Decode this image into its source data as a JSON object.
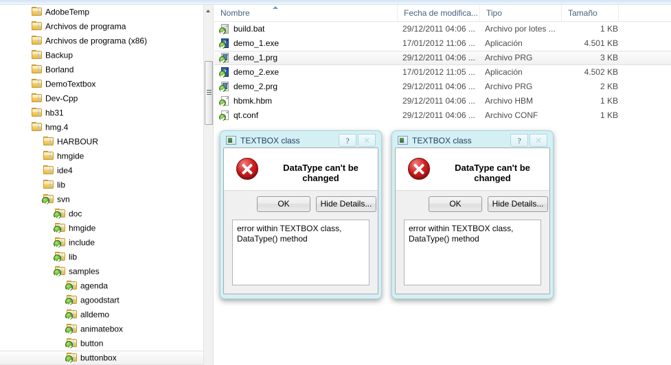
{
  "nav_pane": {
    "items": [
      {
        "label": "AdobeTemp",
        "indent": 0,
        "svn": false
      },
      {
        "label": "Archivos de programa",
        "indent": 0,
        "svn": false
      },
      {
        "label": "Archivos de programa (x86)",
        "indent": 0,
        "svn": false
      },
      {
        "label": "Backup",
        "indent": 0,
        "svn": false
      },
      {
        "label": "Borland",
        "indent": 0,
        "svn": false
      },
      {
        "label": "DemoTextbox",
        "indent": 0,
        "svn": false
      },
      {
        "label": "Dev-Cpp",
        "indent": 0,
        "svn": false
      },
      {
        "label": "hb31",
        "indent": 0,
        "svn": false
      },
      {
        "label": "hmg.4",
        "indent": 0,
        "svn": false
      },
      {
        "label": "HARBOUR",
        "indent": 1,
        "svn": false
      },
      {
        "label": "hmgide",
        "indent": 1,
        "svn": false
      },
      {
        "label": "ide4",
        "indent": 1,
        "svn": false
      },
      {
        "label": "lib",
        "indent": 1,
        "svn": false
      },
      {
        "label": "svn",
        "indent": 1,
        "svn": true
      },
      {
        "label": "doc",
        "indent": 2,
        "svn": true
      },
      {
        "label": "hmgide",
        "indent": 2,
        "svn": true
      },
      {
        "label": "include",
        "indent": 2,
        "svn": true
      },
      {
        "label": "lib",
        "indent": 2,
        "svn": true
      },
      {
        "label": "samples",
        "indent": 2,
        "svn": true
      },
      {
        "label": "agenda",
        "indent": 3,
        "svn": true
      },
      {
        "label": "agoodstart",
        "indent": 3,
        "svn": true
      },
      {
        "label": "alldemo",
        "indent": 3,
        "svn": true
      },
      {
        "label": "animatebox",
        "indent": 3,
        "svn": true
      },
      {
        "label": "button",
        "indent": 3,
        "svn": true
      },
      {
        "label": "buttonbox",
        "indent": 3,
        "svn": true,
        "selected": true
      }
    ]
  },
  "scrollbar": {
    "up_arrow_label": "",
    "thumb_label": ""
  },
  "file_list": {
    "columns": [
      {
        "key": "name",
        "label": "Nombre",
        "sorted": "asc"
      },
      {
        "key": "date",
        "label": "Fecha de modifica..."
      },
      {
        "key": "type",
        "label": "Tipo"
      },
      {
        "key": "size",
        "label": "Tamaño"
      }
    ],
    "rows": [
      {
        "icon": "bat-file-icon",
        "name": "build.bat",
        "date": "29/12/2011 04:06 ...",
        "type": "Archivo por lotes ...",
        "size": "1 KB",
        "selected": false
      },
      {
        "icon": "exe-file-icon",
        "name": "demo_1.exe",
        "date": "17/01/2012 11:06 ...",
        "type": "Aplicación",
        "size": "4.501 KB",
        "selected": false
      },
      {
        "icon": "prg-file-icon",
        "name": "demo_1.prg",
        "date": "29/12/2011 04:06 ...",
        "type": "Archivo PRG",
        "size": "3 KB",
        "selected": true
      },
      {
        "icon": "exe-file-icon",
        "name": "demo_2.exe",
        "date": "17/01/2012 11:05 ...",
        "type": "Aplicación",
        "size": "4.502 KB",
        "selected": false
      },
      {
        "icon": "prg-file-icon",
        "name": "demo_2.prg",
        "date": "29/12/2011 04:06 ...",
        "type": "Archivo PRG",
        "size": "2 KB",
        "selected": false
      },
      {
        "icon": "hbm-file-icon",
        "name": "hbmk.hbm",
        "date": "29/12/2011 04:06 ...",
        "type": "Archivo HBM",
        "size": "1 KB",
        "selected": false
      },
      {
        "icon": "conf-file-icon",
        "name": "qt.conf",
        "date": "29/12/2011 04:06 ...",
        "type": "Archivo CONF",
        "size": "1 KB",
        "selected": false
      }
    ]
  },
  "dialogs": [
    {
      "title": "TEXTBOX class",
      "help_label": "?",
      "close_label": "✕",
      "message": "DataType can't be changed",
      "ok_label": "OK",
      "details_toggle_label": "Hide Details...",
      "details_text": "error within TEXTBOX class,\nDataType() method"
    },
    {
      "title": "TEXTBOX class",
      "help_label": "?",
      "close_label": "✕",
      "message": "DataType can't be changed",
      "ok_label": "OK",
      "details_toggle_label": "Hide Details...",
      "details_text": "error within TEXTBOX class,\nDataType() method"
    }
  ],
  "colors": {
    "dialog_frame": "#d5f0f4",
    "header_text": "#46617c",
    "error_red": "#d42020",
    "svn_green": "#4f9c1f",
    "selection_gray": "#f0f0f0"
  }
}
